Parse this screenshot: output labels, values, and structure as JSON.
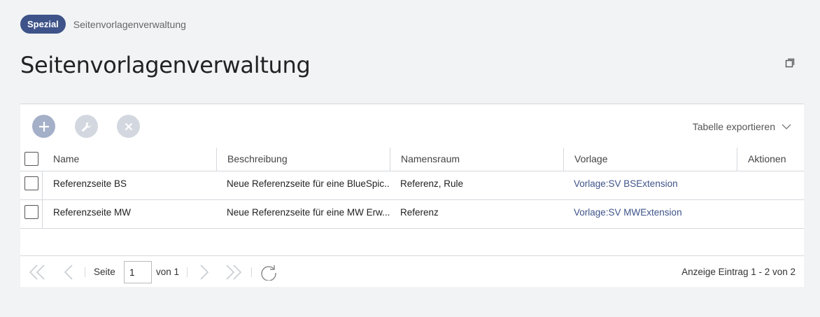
{
  "breadcrumb": {
    "badge": "Spezial",
    "text": "Seitenvorlagenverwaltung"
  },
  "page": {
    "title": "Seitenvorlagenverwaltung"
  },
  "toolbar": {
    "export_label": "Tabelle exportieren"
  },
  "table": {
    "headers": {
      "name": "Name",
      "description": "Beschreibung",
      "namespace": "Namensraum",
      "template": "Vorlage",
      "actions": "Aktionen"
    },
    "rows": [
      {
        "name": "Referenzseite BS",
        "description": "Neue Referenzseite für eine BlueSpic...",
        "namespace": "Referenz, Rule",
        "template": "Vorlage:SV BSExtension"
      },
      {
        "name": "Referenzseite MW",
        "description": "Neue Referenzseite für eine MW Erw...",
        "namespace": "Referenz",
        "template": "Vorlage:SV MWExtension"
      }
    ]
  },
  "pager": {
    "page_label": "Seite",
    "page_value": "1",
    "of_label": "von 1",
    "info": "Anzeige Eintrag 1 - 2 von 2"
  },
  "colors": {
    "accent": "#3e5389",
    "link": "#3e5389",
    "background": "#f1f3f5"
  },
  "icons": [
    "add-icon",
    "wrench-icon",
    "close-icon",
    "chevron-down-icon",
    "popout-icon",
    "first-page-icon",
    "prev-page-icon",
    "next-page-icon",
    "last-page-icon",
    "refresh-icon"
  ]
}
